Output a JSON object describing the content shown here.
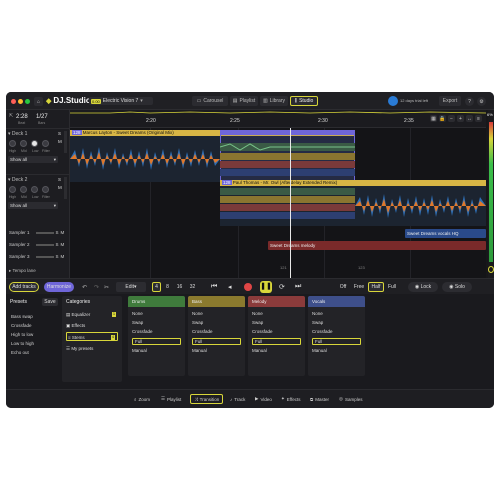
{
  "app": {
    "logo_text": "DJ.Studio",
    "badge": "0.00",
    "project_name": "Electric Vision 7",
    "export_label": "Export"
  },
  "views": [
    {
      "label": "Carousel"
    },
    {
      "label": "Playlist"
    },
    {
      "label": "Library"
    },
    {
      "label": "Studio"
    }
  ],
  "status_text": "12 days trial left",
  "header_info": {
    "time": "2:28",
    "position": "1/27",
    "sub1": "Beat",
    "sub2": "Bars"
  },
  "ruler_ticks": [
    "2:20",
    "2:25",
    "2:30",
    "2:35"
  ],
  "zoom_percent": "6%",
  "decks": [
    {
      "name": "Deck 1",
      "show": "Show all",
      "knobs": [
        "High",
        "Mid",
        "Low",
        "Filter"
      ]
    },
    {
      "name": "Deck 2",
      "show": "Show all",
      "knobs": [
        "High",
        "Mid",
        "Low",
        "Filter"
      ]
    }
  ],
  "samplers": [
    {
      "name": "Sampler 1"
    },
    {
      "name": "Sampler 2"
    },
    {
      "name": "Sampler 3"
    }
  ],
  "tempo_label": "Tempo lane",
  "clips": {
    "clip1": {
      "bpm": "128",
      "title": "Marcus Layton - Sweet Dreams (Original Mix)"
    },
    "clip2": {
      "bpm": "128",
      "title": "Paul Thomas - Mr. Owl (Afterdelay Extended Remix)"
    },
    "clip3": {
      "title": "Sweet Dreams vocals HQ"
    },
    "clip4": {
      "title": "Sweet Dreams melody"
    }
  },
  "markers": {
    "m1": "121",
    "m2": "123"
  },
  "transport": {
    "add_tracks": "Add tracks",
    "harmonize": "Harmonize",
    "edit": "Edit",
    "beats": [
      "4",
      "8",
      "16",
      "32"
    ],
    "sync_modes": [
      "Off",
      "Free",
      "Half",
      "Full"
    ],
    "selected_sync": "Half",
    "lock": "Lock",
    "solo": "Solo"
  },
  "presets": {
    "title": "Presets",
    "save": "Save",
    "items": [
      "Bass swap",
      "Crossfade",
      "High to low",
      "Low to high",
      "Echo out"
    ]
  },
  "categories": {
    "title": "Categories",
    "items": [
      {
        "label": "Equalizer",
        "badge": "1"
      },
      {
        "label": "Effects",
        "badge": ""
      },
      {
        "label": "Stems",
        "badge": "4"
      },
      {
        "label": "My presets",
        "badge": ""
      }
    ]
  },
  "stem_cards": [
    {
      "title": "Drums",
      "color": "#3f7b3c",
      "options": [
        "None",
        "Swap",
        "Crossfade",
        "Full",
        "Manual"
      ],
      "selected": "Full"
    },
    {
      "title": "Bass",
      "color": "#8b7a2e",
      "options": [
        "None",
        "Swap",
        "Crossfade",
        "Full",
        "Manual"
      ],
      "selected": "Full"
    },
    {
      "title": "Melody",
      "color": "#8b3b3b",
      "options": [
        "None",
        "Swap",
        "Crossfade",
        "Full",
        "Manual"
      ],
      "selected": "Full"
    },
    {
      "title": "Vocals",
      "color": "#3e4f8a",
      "options": [
        "None",
        "Swap",
        "Crossfade",
        "Full",
        "Manual"
      ],
      "selected": "Full"
    }
  ],
  "footer_tabs": [
    {
      "label": "Zoom",
      "icon": "zoom-icon"
    },
    {
      "label": "Playlist",
      "icon": "playlist-icon"
    },
    {
      "label": "Transition",
      "icon": "transition-icon"
    },
    {
      "label": "Track",
      "icon": "track-icon"
    },
    {
      "label": "Video",
      "icon": "video-icon"
    },
    {
      "label": "Effects",
      "icon": "effects-icon"
    },
    {
      "label": "Master",
      "icon": "master-icon"
    },
    {
      "label": "Samples",
      "icon": "samples-icon"
    }
  ],
  "active_footer_tab": "Transition",
  "colors": {
    "accent": "#d8d63a",
    "waveform_blue": "#2f6fb5",
    "waveform_orange": "#e0782a",
    "clip_purple": "#6f66d9",
    "clip_gold": "#d7b545",
    "clip_green": "#78c38a",
    "clip_red": "#c04b4b",
    "clip_blue": "#4b7bd0"
  }
}
